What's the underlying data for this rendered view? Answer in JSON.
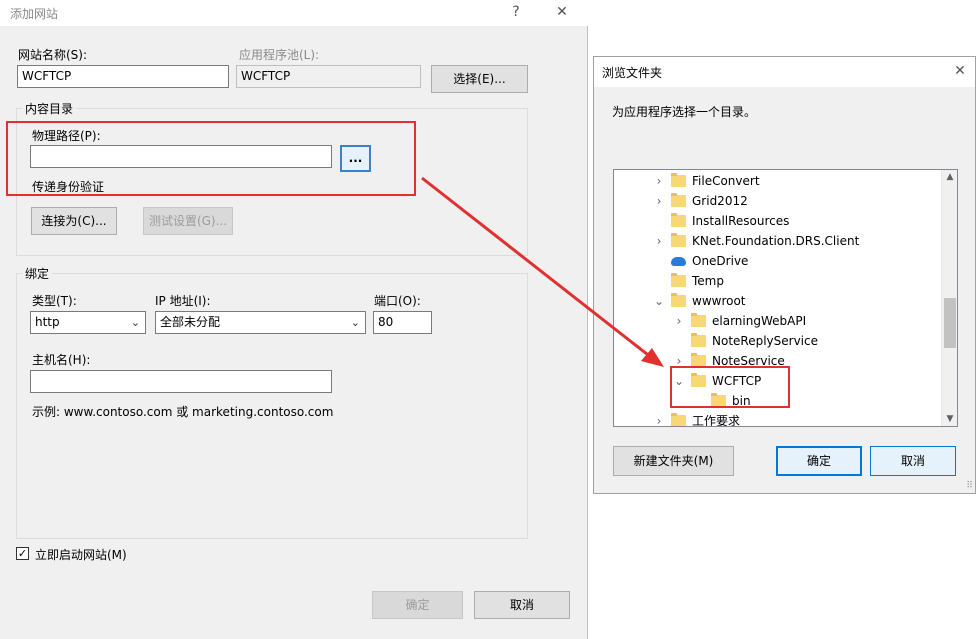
{
  "left_dialog": {
    "title": "添加网站",
    "help_glyph": "?",
    "close_glyph": "✕",
    "site_name_label": "网站名称(S):",
    "site_name_value": "WCFTCP",
    "app_pool_label": "应用程序池(L):",
    "app_pool_value": "WCFTCP",
    "select_button": "选择(E)...",
    "content_dir_group": "内容目录",
    "physical_path_label": "物理路径(P):",
    "physical_path_value": "",
    "browse_button": "...",
    "pass_auth_label": "传递身份验证",
    "connect_as_button": "连接为(C)...",
    "test_settings_button": "测试设置(G)...",
    "binding_group": "绑定",
    "type_label": "类型(T):",
    "type_value": "http",
    "ip_label": "IP 地址(I):",
    "ip_value": "全部未分配",
    "port_label": "端口(O):",
    "port_value": "80",
    "host_label": "主机名(H):",
    "host_value": "",
    "example_text": "示例: www.contoso.com 或 marketing.contoso.com",
    "start_site_label": "立即启动网站(M)",
    "start_site_checked": true,
    "check_glyph": "✓",
    "ok_button": "确定",
    "cancel_button": "取消"
  },
  "right_dialog": {
    "title": "浏览文件夹",
    "close_glyph": "✕",
    "instruction": "为应用程序选择一个目录。",
    "tree_items": [
      {
        "label": "FileConvert",
        "chevron": "›",
        "icon": "folder-icon"
      },
      {
        "label": "Grid2012",
        "chevron": "›",
        "icon": "folder-icon"
      },
      {
        "label": "InstallResources",
        "chevron": "",
        "icon": "folder-icon"
      },
      {
        "label": "KNet.Foundation.DRS.Client",
        "chevron": "›",
        "icon": "folder-icon"
      },
      {
        "label": "OneDrive",
        "chevron": "",
        "icon": "cloud-icon"
      },
      {
        "label": "Temp",
        "chevron": "",
        "icon": "folder-icon"
      },
      {
        "label": "wwwroot",
        "chevron": "⌄",
        "icon": "folder-icon"
      },
      {
        "label": "elarningWebAPI",
        "chevron": "›",
        "icon": "folder-icon"
      },
      {
        "label": "NoteReplyService",
        "chevron": "",
        "icon": "folder-icon"
      },
      {
        "label": "NoteService",
        "chevron": "›",
        "icon": "folder-icon"
      },
      {
        "label": "WCFTCP",
        "chevron": "⌄",
        "icon": "folder-icon"
      },
      {
        "label": "bin",
        "chevron": "",
        "icon": "folder-icon"
      },
      {
        "label": "工作要求",
        "chevron": "›",
        "icon": "folder-icon"
      }
    ],
    "new_folder_button": "新建文件夹(M)",
    "ok_button": "确定",
    "cancel_button": "取消"
  },
  "colors": {
    "highlight_red": "#e03030",
    "accent_blue": "#0078d7",
    "folder_yellow": "#f8d775"
  }
}
